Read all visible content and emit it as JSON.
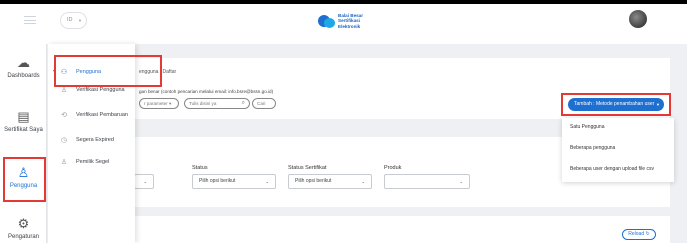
{
  "header": {
    "language": "ID",
    "logo_lines": [
      "Balai Besar",
      "Sertifikasi",
      "Elektronik"
    ]
  },
  "rail": {
    "items": [
      {
        "label": "Dashboards",
        "icon": "cloud-icon"
      },
      {
        "label": "Sertifikat Saya",
        "icon": "certificate-icon"
      },
      {
        "label": "Pengguna",
        "icon": "user-icon"
      },
      {
        "label": "Pengaturan",
        "icon": "gear-icon"
      }
    ]
  },
  "submenu": {
    "items": [
      {
        "label": "Pengguna",
        "icon": "users-icon",
        "active": true
      },
      {
        "label": "Verifikasi Pengguna",
        "icon": "user-check-icon"
      },
      {
        "label": "Verifikasi Pembaruan",
        "icon": "refresh-user-icon"
      },
      {
        "label": "Segera Expired",
        "icon": "clock-icon"
      },
      {
        "label": "Pemilik Segel",
        "icon": "seal-owner-icon"
      }
    ]
  },
  "main": {
    "breadcrumb": "engguna  |  Daftar",
    "hint": "gan benar (contoh pencarian melalui email: info.bsre@bssn.go.id)",
    "param_select": "r parameter",
    "search_placeholder": "Tulis disini ya",
    "search_button": "Cari"
  },
  "add_menu": {
    "button_label": "Tambah : Metode penambahan user",
    "options": [
      "Satu Pengguna",
      "Beberapa pengguna",
      "Beberapa user dengan upload file csv"
    ]
  },
  "filters": {
    "status_label": "Status",
    "status_value": "Pilih opsi berikut",
    "cert_status_label": "Status Sertifikat",
    "cert_status_value": "Pilih opsi berikut",
    "product_label": "Produk",
    "product_value": ""
  },
  "table": {
    "reload_label": "Reload"
  },
  "colors": {
    "primary": "#1e6fd0",
    "highlight": "#e53935"
  }
}
